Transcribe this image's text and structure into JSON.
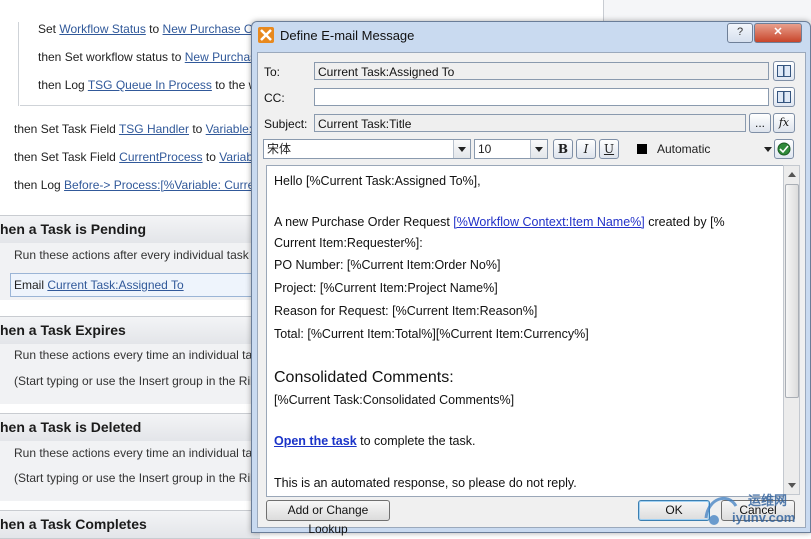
{
  "background": {
    "actions_top": [
      {
        "prefix": "Set ",
        "link": "Workflow Status",
        "mid": " to ",
        "link2": "New Purchase Or"
      },
      {
        "prefix": "then Set workflow status to ",
        "link": "New Purchas",
        "mid": "",
        "link2": ""
      },
      {
        "prefix": "then Log ",
        "link": "TSG Queue In Process",
        "mid": "  to the w",
        "link2": ""
      }
    ],
    "actions_mid": [
      {
        "prefix": "then Set Task Field ",
        "link": "TSG Handler",
        "mid": " to ",
        "link2": "Variable: T"
      },
      {
        "prefix": "then Set Task Field ",
        "link": "CurrentProcess",
        "mid": " to ",
        "link2": "Variable"
      },
      {
        "prefix": "then Log ",
        "link": "Before-> Process:[%Variable: Curre",
        "mid": "",
        "link2": ""
      }
    ],
    "steps": [
      {
        "header": "hen a Task is Pending",
        "line1": "Run these actions after every individual task h",
        "line2": ""
      },
      {
        "header": "hen a Task Expires",
        "line1": "Run these actions every time an individual tas",
        "line2": "(Start typing or use the Insert group in the Rib"
      },
      {
        "header": "hen a Task is Deleted",
        "line1": "Run these actions every time an individual tas",
        "line2": "(Start typing or use the Insert group in the Rib"
      },
      {
        "header": "hen a Task Completes",
        "line1": "",
        "line2": ""
      }
    ],
    "email_action": {
      "prefix": "Email ",
      "link": "Current Task:Assigned To"
    }
  },
  "dialog": {
    "title": "Define E-mail Message",
    "to_label": "To:",
    "to_value": "Current Task:Assigned To",
    "cc_label": "CC:",
    "cc_value": "",
    "subject_label": "Subject:",
    "subject_value": "Current Task:Title",
    "ellipsis_label": "...",
    "fx_label": "fx",
    "font_name": "宋体",
    "font_size": "10",
    "bold_label": "B",
    "italic_label": "I",
    "underline_label": "U",
    "color_label": "Automatic",
    "colors": {
      "text_color": "#000000"
    },
    "body": {
      "greeting_prefix": "Hello  ",
      "greeting_lookup": "[%Current Task:Assigned To%],",
      "request_prefix": "A new Purchase Order Request  ",
      "request_link": "[%Workflow Context:Item Name%]",
      "request_mid": " created by  [%",
      "request_cont": "Current Item:Requester%]:",
      "po_line": "PO Number:  [%Current Item:Order No%]",
      "project_line": "Project:  [%Current Item:Project Name%]",
      "reason_line": "Reason for Request:  [%Current Item:Reason%]",
      "total_line": "Total:  [%Current Item:Total%][%Current Item:Currency%]",
      "comments_heading": "Consolidated Comments:",
      "comments_lookup": "[%Current Task:Consolidated Comments%]",
      "open_link": "Open the task",
      "open_suffix": "  to complete the task.",
      "footer": "This is an automated response, so please do not reply."
    },
    "lookup_button": "Add or Change Lookup",
    "ok_button": "OK",
    "cancel_button": "Cancel"
  },
  "watermark": {
    "line1": "运维网",
    "line2": "iyunv.com"
  }
}
